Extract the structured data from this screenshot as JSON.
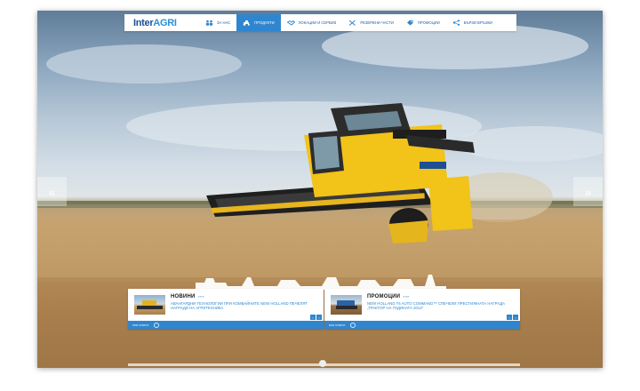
{
  "logo": {
    "part1": "Inter",
    "part2": "AGRI"
  },
  "nav": {
    "items": [
      {
        "label": "ЗА НАС",
        "icon": "people-icon",
        "active": false
      },
      {
        "label": "ПРОДУКТИ",
        "icon": "tractor-icon",
        "active": true
      },
      {
        "label": "ЛОКАЦИИ И СЕРВИЗ",
        "icon": "handshake-icon",
        "active": false
      },
      {
        "label": "РЕЗЕРВНИ ЧАСТИ",
        "icon": "tools-icon",
        "active": false
      },
      {
        "label": "ПРОМОЦИИ",
        "icon": "tag-icon",
        "active": false
      },
      {
        "label": "БЪРЗИ ВРЪЗКИ",
        "icon": "share-icon",
        "active": false
      }
    ]
  },
  "slider": {
    "prev": "«",
    "next": "»"
  },
  "news": {
    "title": "НОВИНИ",
    "dots": "»»»",
    "text": "АВАНГАРДНИ ТЕХНОЛОГИИ ПРИ КОМБАЙНИТЕ NEW HOLLAND ПЕЧЕЛЯТ НАГРАДИ НА АГРИТЕХНИКА",
    "prev": "‹",
    "next": "›",
    "footer": "виж повече"
  },
  "promo": {
    "title": "ПРОМОЦИИ",
    "dots": "»»»",
    "text": "NEW HOLLAND T6 AUTO COMMAND™ СПЕЧЕЛИ ПРЕСТИЖНАТА НАГРАДА „ТРАКТОР НА ГОДИНАТА 2014\"",
    "prev": "‹",
    "next": "›",
    "footer": "виж повече"
  },
  "colors": {
    "accent": "#2f86cf",
    "brand_dark": "#1c4f93",
    "harvester": "#f2c318"
  }
}
